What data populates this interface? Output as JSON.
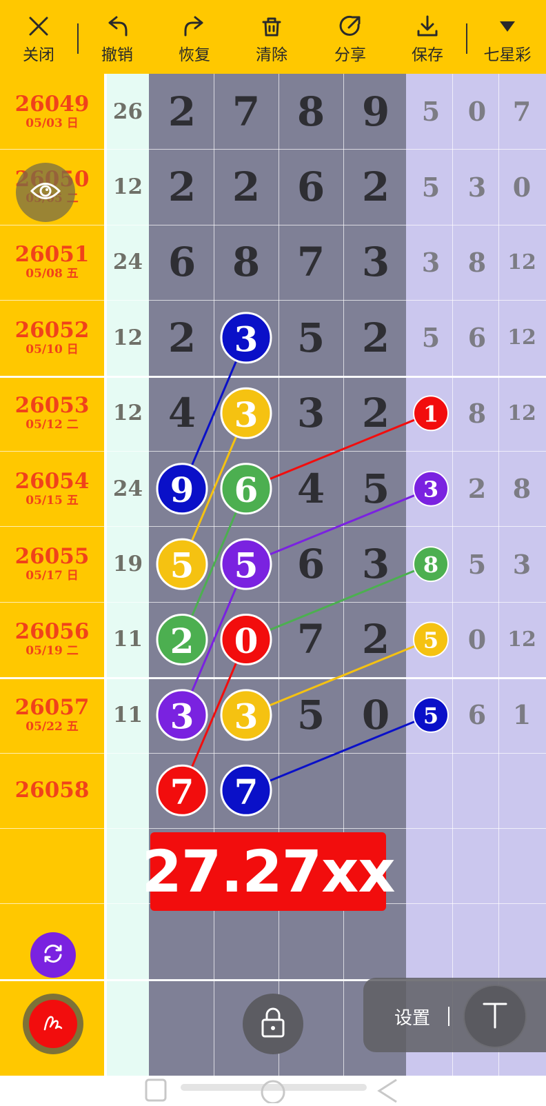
{
  "toolbar": {
    "close": "关闭",
    "undo": "撤销",
    "redo": "恢复",
    "clear": "清除",
    "share": "分享",
    "save": "保存",
    "lottery": "七星彩"
  },
  "rows": [
    {
      "issue": "26049",
      "date": "05/03 日",
      "sum": "26",
      "main": [
        "2",
        "7",
        "8",
        "9"
      ],
      "side": [
        "5",
        "0",
        "7"
      ]
    },
    {
      "issue": "26050",
      "date": "05/05 二",
      "sum": "12",
      "main": [
        "2",
        "2",
        "6",
        "2"
      ],
      "side": [
        "5",
        "3",
        "0"
      ]
    },
    {
      "issue": "26051",
      "date": "05/08 五",
      "sum": "24",
      "main": [
        "6",
        "8",
        "7",
        "3"
      ],
      "side": [
        "3",
        "8",
        "12"
      ]
    },
    {
      "issue": "26052",
      "date": "05/10 日",
      "sum": "12",
      "main": [
        "2",
        "3",
        "5",
        "2"
      ],
      "side": [
        "5",
        "6",
        "12"
      ]
    },
    {
      "issue": "26053",
      "date": "05/12 二",
      "sum": "12",
      "main": [
        "4",
        "3",
        "3",
        "2"
      ],
      "side": [
        "1",
        "8",
        "12"
      ]
    },
    {
      "issue": "26054",
      "date": "05/15 五",
      "sum": "24",
      "main": [
        "9",
        "6",
        "4",
        "5"
      ],
      "side": [
        "3",
        "2",
        "8"
      ]
    },
    {
      "issue": "26055",
      "date": "05/17 日",
      "sum": "19",
      "main": [
        "5",
        "5",
        "6",
        "3"
      ],
      "side": [
        "8",
        "5",
        "3"
      ]
    },
    {
      "issue": "26056",
      "date": "05/19 二",
      "sum": "11",
      "main": [
        "2",
        "0",
        "7",
        "2"
      ],
      "side": [
        "5",
        "0",
        "12"
      ]
    },
    {
      "issue": "26057",
      "date": "05/22 五",
      "sum": "11",
      "main": [
        "3",
        "3",
        "5",
        "0"
      ],
      "side": [
        "5",
        "6",
        "1"
      ]
    },
    {
      "issue": "26058",
      "date": "",
      "sum": "",
      "main": [
        "7",
        "7",
        "",
        ""
      ],
      "side": [
        "",
        "",
        ""
      ]
    }
  ],
  "highlights": [
    {
      "row": 3,
      "col": 1,
      "color": "#0A10C8"
    },
    {
      "row": 4,
      "col": 1,
      "color": "#F5C211"
    },
    {
      "row": 4,
      "col": 4,
      "color": "#F20D0D"
    },
    {
      "row": 5,
      "col": 0,
      "color": "#0A10C8"
    },
    {
      "row": 5,
      "col": 1,
      "color": "#4CAF50"
    },
    {
      "row": 5,
      "col": 4,
      "color": "#7A22E0"
    },
    {
      "row": 6,
      "col": 0,
      "color": "#F5C211"
    },
    {
      "row": 6,
      "col": 1,
      "color": "#7A22E0"
    },
    {
      "row": 6,
      "col": 4,
      "color": "#4CAF50"
    },
    {
      "row": 7,
      "col": 0,
      "color": "#4CAF50"
    },
    {
      "row": 7,
      "col": 1,
      "color": "#F20D0D"
    },
    {
      "row": 7,
      "col": 4,
      "color": "#F5C211"
    },
    {
      "row": 8,
      "col": 0,
      "color": "#7A22E0"
    },
    {
      "row": 8,
      "col": 1,
      "color": "#F5C211"
    },
    {
      "row": 8,
      "col": 4,
      "color": "#0A10C8"
    },
    {
      "row": 9,
      "col": 0,
      "color": "#F20D0D"
    },
    {
      "row": 9,
      "col": 1,
      "color": "#0A10C8"
    }
  ],
  "links": [
    {
      "from": [
        3,
        1
      ],
      "to": [
        5,
        0
      ],
      "color": "#0A10C8"
    },
    {
      "from": [
        4,
        1
      ],
      "to": [
        6,
        0
      ],
      "color": "#F5C211"
    },
    {
      "from": [
        5,
        1
      ],
      "to": [
        7,
        0
      ],
      "color": "#4CAF50"
    },
    {
      "from": [
        6,
        1
      ],
      "to": [
        8,
        0
      ],
      "color": "#7A22E0"
    },
    {
      "from": [
        7,
        1
      ],
      "to": [
        9,
        0
      ],
      "color": "#F20D0D"
    },
    {
      "from": [
        4,
        4
      ],
      "to": [
        5,
        1
      ],
      "color": "#F20D0D"
    },
    {
      "from": [
        5,
        4
      ],
      "to": [
        6,
        1
      ],
      "color": "#7A22E0"
    },
    {
      "from": [
        6,
        4
      ],
      "to": [
        7,
        1
      ],
      "color": "#4CAF50"
    },
    {
      "from": [
        7,
        4
      ],
      "to": [
        8,
        1
      ],
      "color": "#F5C211"
    },
    {
      "from": [
        8,
        4
      ],
      "to": [
        9,
        1
      ],
      "color": "#0A10C8"
    }
  ],
  "result": "27.27xx",
  "settings": {
    "label": "设置"
  },
  "icons": {
    "close": "close-icon",
    "undo": "undo-icon",
    "redo": "redo-icon",
    "clear": "trash-icon",
    "share": "share-icon",
    "save": "download-icon",
    "lottery": "caret-down-icon",
    "eye": "eye-icon",
    "refresh": "refresh-icon",
    "pen": "pen-icon",
    "lock": "lock-icon",
    "text": "text-icon"
  },
  "colors": {
    "accent": "#FFC800",
    "issue_text": "#F0421A",
    "main_bg": "#7F8096",
    "side_bg": "#CBC7EE",
    "sum_bg": "#E6FBF4",
    "result_bg": "#F20D0D"
  }
}
